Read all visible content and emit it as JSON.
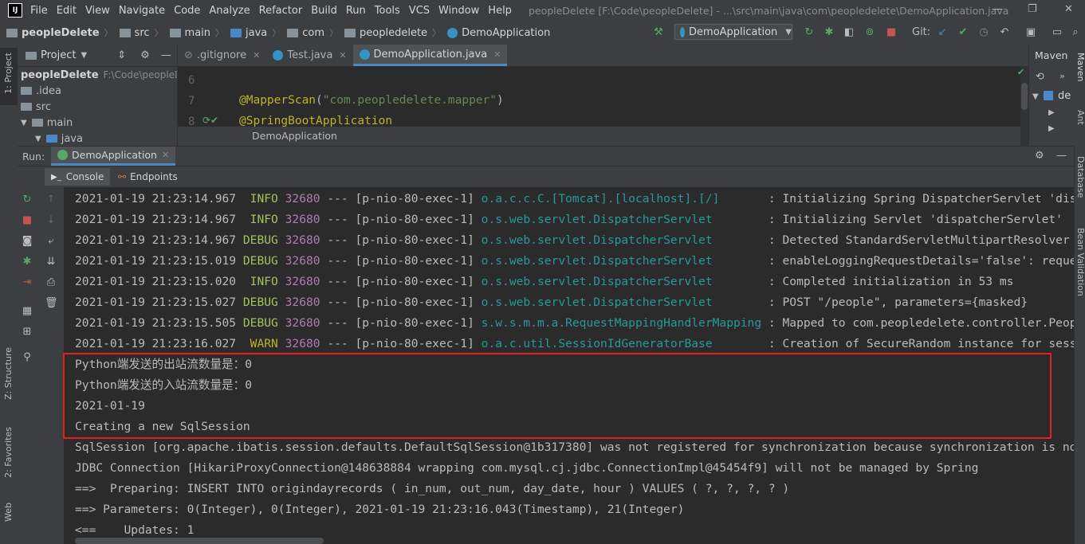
{
  "menu": {
    "items": [
      "File",
      "Edit",
      "View",
      "Navigate",
      "Code",
      "Analyze",
      "Refactor",
      "Build",
      "Run",
      "Tools",
      "VCS",
      "Window",
      "Help"
    ],
    "window_title": "peopleDelete [F:\\Code\\peopleDelete] - ...\\src\\main\\java\\com\\peopledelete\\DemoApplication.java"
  },
  "breadcrumb": [
    "peopleDelete",
    "src",
    "main",
    "java",
    "com",
    "peopledelete",
    "DemoApplication"
  ],
  "toolbar": {
    "run_config": "DemoApplication",
    "git_label": "Git:"
  },
  "left_strip": {
    "project": "1: Project",
    "structure": "Z: Structure",
    "favorites": "2: Favorites",
    "web": "Web"
  },
  "right_strip": {
    "maven": "Maven",
    "ant": "Ant",
    "database": "Database",
    "bean": "Bean Validation"
  },
  "project_panel": {
    "title": "Project",
    "root": "peopleDelete",
    "root_path": "F:\\Code\\peopleDe",
    "items": [
      ".idea",
      "src",
      "main",
      "java"
    ]
  },
  "editor": {
    "tabs": [
      ".gitignore",
      "Test.java",
      "DemoApplication.java"
    ],
    "lines": [
      {
        "num": "6",
        "text": ""
      },
      {
        "num": "7",
        "ann": "@MapperScan",
        "open": "(",
        "str": "\"com.peopledelete.mapper\"",
        "close": ")"
      },
      {
        "num": "8",
        "ann": "@SpringBootApplication"
      }
    ],
    "breadcrumb_hint": "DemoApplication"
  },
  "maven_panel": {
    "title": "Maven",
    "item": "de"
  },
  "run_panel": {
    "label": "Run:",
    "tab": "DemoApplication",
    "subtabs": [
      "Console",
      "Endpoints"
    ]
  },
  "console": {
    "log_lines": [
      {
        "ts": "2021-01-19 21:23:14.967",
        "level": " INFO",
        "pid": "32680",
        "thread": "--- [p-nio-80-exec-1]",
        "logger": "o.a.c.c.C.[Tomcat].[localhost].[/]      ",
        "msg": ": Initializing Spring DispatcherServlet 'dispatcherServlet'"
      },
      {
        "ts": "2021-01-19 21:23:14.967",
        "level": " INFO",
        "pid": "32680",
        "thread": "--- [p-nio-80-exec-1]",
        "logger": "o.s.web.servlet.DispatcherServlet       ",
        "msg": ": Initializing Servlet 'dispatcherServlet'"
      },
      {
        "ts": "2021-01-19 21:23:14.967",
        "level": "DEBUG",
        "pid": "32680",
        "thread": "--- [p-nio-80-exec-1]",
        "logger": "o.s.web.servlet.DispatcherServlet       ",
        "msg": ": Detected StandardServletMultipartResolver"
      },
      {
        "ts": "2021-01-19 21:23:15.019",
        "level": "DEBUG",
        "pid": "32680",
        "thread": "--- [p-nio-80-exec-1]",
        "logger": "o.s.web.servlet.DispatcherServlet       ",
        "msg": ": enableLoggingRequestDetails='false': request"
      },
      {
        "ts": "2021-01-19 21:23:15.020",
        "level": " INFO",
        "pid": "32680",
        "thread": "--- [p-nio-80-exec-1]",
        "logger": "o.s.web.servlet.DispatcherServlet       ",
        "msg": ": Completed initialization in 53 ms"
      },
      {
        "ts": "2021-01-19 21:23:15.027",
        "level": "DEBUG",
        "pid": "32680",
        "thread": "--- [p-nio-80-exec-1]",
        "logger": "o.s.web.servlet.DispatcherServlet       ",
        "msg": ": POST \"/people\", parameters={masked}"
      },
      {
        "ts": "2021-01-19 21:23:15.505",
        "level": "DEBUG",
        "pid": "32680",
        "thread": "--- [p-nio-80-exec-1]",
        "logger": "s.w.s.m.m.a.RequestMappingHandlerMapping",
        "msg": ": Mapped to com.peopledelete.controller.People"
      },
      {
        "ts": "2021-01-19 21:23:16.027",
        "level": " WARN",
        "pid": "32680",
        "thread": "--- [p-nio-80-exec-1]",
        "logger": "o.a.c.util.SessionIdGeneratorBase       ",
        "msg": ": Creation of SecureRandom instance for session"
      }
    ],
    "plain_lines": [
      "Python端发送的出站流数量是：0",
      "Python端发送的入站流数量是：0",
      "2021-01-19",
      "Creating a new SqlSession",
      "SqlSession [org.apache.ibatis.session.defaults.DefaultSqlSession@1b317380] was not registered for synchronization because synchronization is not active",
      "JDBC Connection [HikariProxyConnection@148638884 wrapping com.mysql.cj.jdbc.ConnectionImpl@45454f9] will not be managed by Spring",
      "==>  Preparing: INSERT INTO origindayrecords ( in_num, out_num, day_date, hour ) VALUES ( ?, ?, ?, ? )",
      "==> Parameters: 0(Integer), 0(Integer), 2021-01-19 21:23:16.043(Timestamp), 21(Integer)",
      "<==    Updates: 1"
    ]
  }
}
